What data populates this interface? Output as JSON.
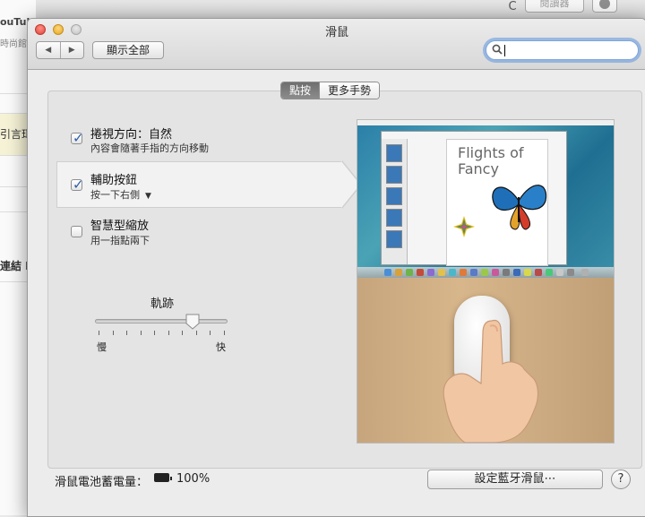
{
  "background_browser": {
    "reload_glyph": "C",
    "reader_label": "閱讀器",
    "texts": [
      "ouTub",
      "時尚館",
      "引言珥",
      "連結 I"
    ]
  },
  "window": {
    "title": "滑鼠",
    "nav_back": "◀",
    "nav_forward": "▶",
    "show_all": "顯示全部",
    "search": {
      "value": "",
      "placeholder": ""
    }
  },
  "tabs": [
    {
      "label": "點按",
      "active": true
    },
    {
      "label": "更多手勢",
      "active": false
    }
  ],
  "options": [
    {
      "title": "捲視方向：自然",
      "subtitle": "內容會隨著手指的方向移動",
      "checked": true
    },
    {
      "title": "輔助按鈕",
      "subtitle": "按一下右側",
      "checked": true
    },
    {
      "title": "智慧型縮放",
      "subtitle": "用一指點兩下",
      "checked": false
    }
  ],
  "tracking": {
    "label": "軌跡",
    "min_label": "慢",
    "max_label": "快",
    "level": 0.75
  },
  "preview": {
    "doc_title_line1": "Flights of",
    "doc_title_line2": "Fancy"
  },
  "footer": {
    "battery_label": "滑鼠電池蓄電量：",
    "battery_value": "100%",
    "bluetooth_button": "設定藍牙滑鼠⋯",
    "help": "?"
  },
  "colors": {
    "accent": "#2b5ea7",
    "search_focus": "#5c96e0",
    "tab_active": "#7a7a7a"
  }
}
